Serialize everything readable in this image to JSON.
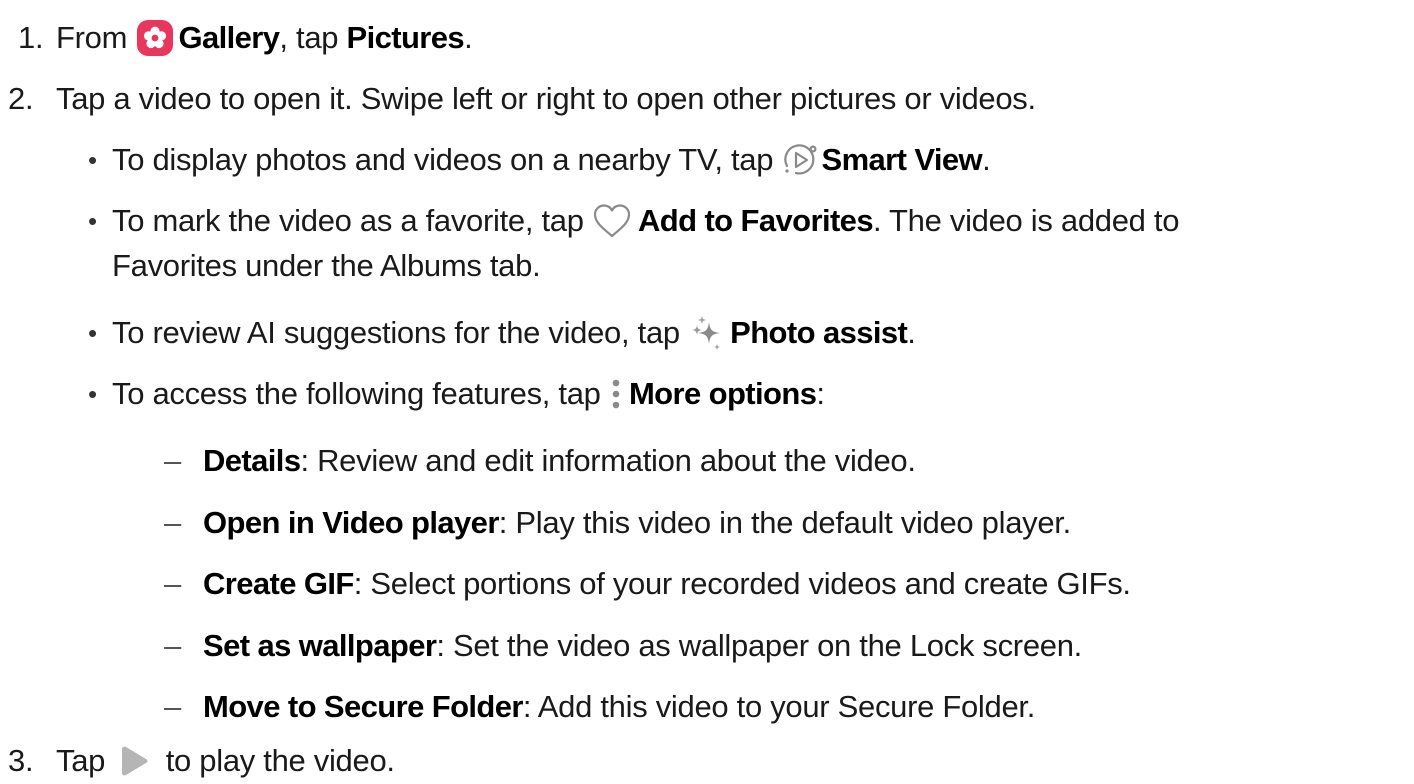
{
  "steps": [
    {
      "number": "1.",
      "text_before": "From ",
      "gallery_label": "Gallery",
      "text_mid": ", tap ",
      "pictures_label": "Pictures",
      "text_end": "."
    },
    {
      "number": "2.",
      "text": "Tap a video to open it. Swipe left or right to open other pictures or videos.",
      "bullets": [
        {
          "before": "To display photos and videos on a nearby TV, tap ",
          "label": "Smart View",
          "after": "."
        },
        {
          "before": "To mark the video as a favorite, tap ",
          "label": "Add to Favorites",
          "after": ". The video is added to",
          "continuation": "Favorites under the Albums tab."
        },
        {
          "before": "To review AI suggestions for the video, tap ",
          "label": "Photo assist",
          "after": "."
        },
        {
          "before": "To access the following features, tap ",
          "label": "More options",
          "after": ":"
        }
      ],
      "subitems": [
        {
          "term": "Details",
          "desc": ": Review and edit information about the video."
        },
        {
          "term": "Open in Video player",
          "desc": ": Play this video in the default video player."
        },
        {
          "term": "Create GIF",
          "desc": ": Select portions of your recorded videos and create GIFs."
        },
        {
          "term": "Set as wallpaper",
          "desc": ": Set the video as wallpaper on the Lock screen."
        },
        {
          "term": "Move to Secure Folder",
          "desc": ": Add this video to your Secure Folder."
        }
      ]
    },
    {
      "number": "3.",
      "before": "Tap ",
      "after": " to play the video."
    }
  ],
  "icons": {
    "gallery": "gallery-flower-icon",
    "smart_view": "smart-view-icon",
    "favorite": "heart-outline-icon",
    "photo_assist": "sparkle-icon",
    "more_options": "vertical-dots-icon",
    "play": "play-icon"
  },
  "colors": {
    "gallery_icon_bg": "#e8365d",
    "icon_gray": "#8a8a8a",
    "text": "#1a1a1a"
  }
}
